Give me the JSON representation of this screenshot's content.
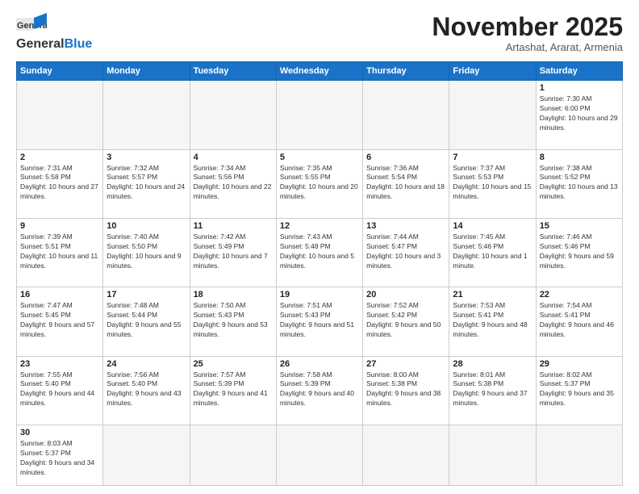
{
  "logo": {
    "text_general": "General",
    "text_blue": "Blue"
  },
  "header": {
    "month": "November 2025",
    "location": "Artashat, Ararat, Armenia"
  },
  "weekdays": [
    "Sunday",
    "Monday",
    "Tuesday",
    "Wednesday",
    "Thursday",
    "Friday",
    "Saturday"
  ],
  "weeks": [
    [
      {
        "day": "",
        "empty": true
      },
      {
        "day": "",
        "empty": true
      },
      {
        "day": "",
        "empty": true
      },
      {
        "day": "",
        "empty": true
      },
      {
        "day": "",
        "empty": true
      },
      {
        "day": "",
        "empty": true
      },
      {
        "day": "1",
        "sunrise": "7:30 AM",
        "sunset": "6:00 PM",
        "daylight": "10 hours and 29 minutes."
      }
    ],
    [
      {
        "day": "2",
        "sunrise": "7:31 AM",
        "sunset": "5:58 PM",
        "daylight": "10 hours and 27 minutes."
      },
      {
        "day": "3",
        "sunrise": "7:32 AM",
        "sunset": "5:57 PM",
        "daylight": "10 hours and 24 minutes."
      },
      {
        "day": "4",
        "sunrise": "7:34 AM",
        "sunset": "5:56 PM",
        "daylight": "10 hours and 22 minutes."
      },
      {
        "day": "5",
        "sunrise": "7:35 AM",
        "sunset": "5:55 PM",
        "daylight": "10 hours and 20 minutes."
      },
      {
        "day": "6",
        "sunrise": "7:36 AM",
        "sunset": "5:54 PM",
        "daylight": "10 hours and 18 minutes."
      },
      {
        "day": "7",
        "sunrise": "7:37 AM",
        "sunset": "5:53 PM",
        "daylight": "10 hours and 15 minutes."
      },
      {
        "day": "8",
        "sunrise": "7:38 AM",
        "sunset": "5:52 PM",
        "daylight": "10 hours and 13 minutes."
      }
    ],
    [
      {
        "day": "9",
        "sunrise": "7:39 AM",
        "sunset": "5:51 PM",
        "daylight": "10 hours and 11 minutes."
      },
      {
        "day": "10",
        "sunrise": "7:40 AM",
        "sunset": "5:50 PM",
        "daylight": "10 hours and 9 minutes."
      },
      {
        "day": "11",
        "sunrise": "7:42 AM",
        "sunset": "5:49 PM",
        "daylight": "10 hours and 7 minutes."
      },
      {
        "day": "12",
        "sunrise": "7:43 AM",
        "sunset": "5:48 PM",
        "daylight": "10 hours and 5 minutes."
      },
      {
        "day": "13",
        "sunrise": "7:44 AM",
        "sunset": "5:47 PM",
        "daylight": "10 hours and 3 minutes."
      },
      {
        "day": "14",
        "sunrise": "7:45 AM",
        "sunset": "5:46 PM",
        "daylight": "10 hours and 1 minute."
      },
      {
        "day": "15",
        "sunrise": "7:46 AM",
        "sunset": "5:46 PM",
        "daylight": "9 hours and 59 minutes."
      }
    ],
    [
      {
        "day": "16",
        "sunrise": "7:47 AM",
        "sunset": "5:45 PM",
        "daylight": "9 hours and 57 minutes."
      },
      {
        "day": "17",
        "sunrise": "7:48 AM",
        "sunset": "5:44 PM",
        "daylight": "9 hours and 55 minutes."
      },
      {
        "day": "18",
        "sunrise": "7:50 AM",
        "sunset": "5:43 PM",
        "daylight": "9 hours and 53 minutes."
      },
      {
        "day": "19",
        "sunrise": "7:51 AM",
        "sunset": "5:43 PM",
        "daylight": "9 hours and 51 minutes."
      },
      {
        "day": "20",
        "sunrise": "7:52 AM",
        "sunset": "5:42 PM",
        "daylight": "9 hours and 50 minutes."
      },
      {
        "day": "21",
        "sunrise": "7:53 AM",
        "sunset": "5:41 PM",
        "daylight": "9 hours and 48 minutes."
      },
      {
        "day": "22",
        "sunrise": "7:54 AM",
        "sunset": "5:41 PM",
        "daylight": "9 hours and 46 minutes."
      }
    ],
    [
      {
        "day": "23",
        "sunrise": "7:55 AM",
        "sunset": "5:40 PM",
        "daylight": "9 hours and 44 minutes."
      },
      {
        "day": "24",
        "sunrise": "7:56 AM",
        "sunset": "5:40 PM",
        "daylight": "9 hours and 43 minutes."
      },
      {
        "day": "25",
        "sunrise": "7:57 AM",
        "sunset": "5:39 PM",
        "daylight": "9 hours and 41 minutes."
      },
      {
        "day": "26",
        "sunrise": "7:58 AM",
        "sunset": "5:39 PM",
        "daylight": "9 hours and 40 minutes."
      },
      {
        "day": "27",
        "sunrise": "8:00 AM",
        "sunset": "5:38 PM",
        "daylight": "9 hours and 38 minutes."
      },
      {
        "day": "28",
        "sunrise": "8:01 AM",
        "sunset": "5:38 PM",
        "daylight": "9 hours and 37 minutes."
      },
      {
        "day": "29",
        "sunrise": "8:02 AM",
        "sunset": "5:37 PM",
        "daylight": "9 hours and 35 minutes."
      }
    ],
    [
      {
        "day": "30",
        "sunrise": "8:03 AM",
        "sunset": "5:37 PM",
        "daylight": "9 hours and 34 minutes.",
        "last": true
      },
      {
        "day": "",
        "empty": true,
        "last": true
      },
      {
        "day": "",
        "empty": true,
        "last": true
      },
      {
        "day": "",
        "empty": true,
        "last": true
      },
      {
        "day": "",
        "empty": true,
        "last": true
      },
      {
        "day": "",
        "empty": true,
        "last": true
      },
      {
        "day": "",
        "empty": true,
        "last": true
      }
    ]
  ]
}
